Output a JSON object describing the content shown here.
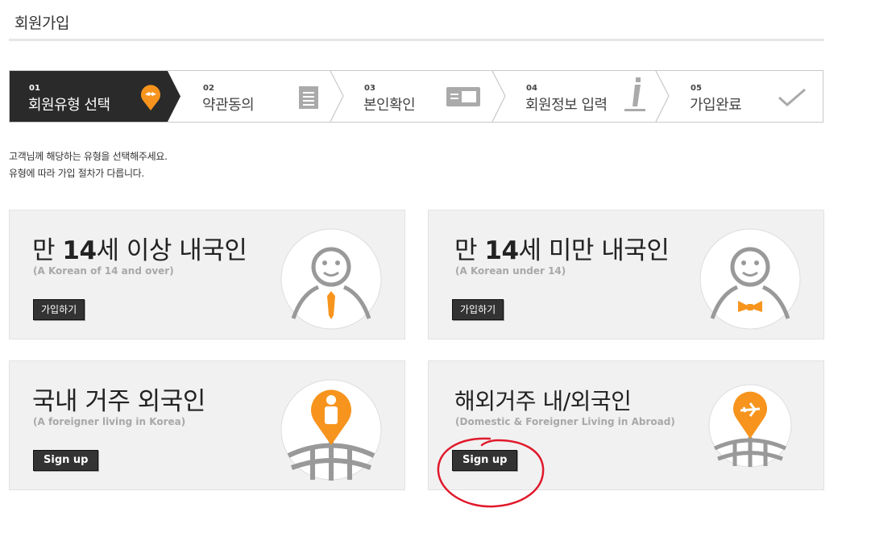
{
  "page": {
    "title": "회원가입"
  },
  "steps": [
    {
      "num": "01",
      "label": "회원유형 선택",
      "icon": "pin-icon",
      "active": true
    },
    {
      "num": "02",
      "label": "약관동의",
      "icon": "document-icon",
      "active": false
    },
    {
      "num": "03",
      "label": "본인확인",
      "icon": "id-card-icon",
      "active": false
    },
    {
      "num": "04",
      "label": "회원정보 입력",
      "icon": "pencil-icon",
      "active": false
    },
    {
      "num": "05",
      "label": "가입완료",
      "icon": "checkmark-icon",
      "active": false
    }
  ],
  "description": {
    "line1": "고객님께 해당하는 유형을 선택해주세요.",
    "line2": "유형에 따라 가입 절차가 다릅니다."
  },
  "cards": [
    {
      "title_prefix": "만 ",
      "title_bold": "14",
      "title_suffix": "세 이상 내국인",
      "subtitle": "(A Korean of 14 and over)",
      "button": "가입하기",
      "icon": "adult-person-icon"
    },
    {
      "title_prefix": "만 ",
      "title_bold": "14",
      "title_suffix": "세 미만 내국인",
      "subtitle": "(A Korean under 14)",
      "button": "가입하기",
      "icon": "child-person-icon"
    },
    {
      "title": "국내 거주 외국인",
      "subtitle": "(A foreigner living in Korea)",
      "button": "Sign up",
      "icon": "globe-person-pin-icon"
    },
    {
      "title": "해외거주 내/외국인",
      "subtitle": "(Domestic & Foreigner Living in Abroad)",
      "button": "Sign up",
      "icon": "globe-airplane-pin-icon"
    }
  ],
  "colors": {
    "accent": "#f7941d",
    "dark": "#2a2a2a",
    "annotation": "#e0192b"
  }
}
